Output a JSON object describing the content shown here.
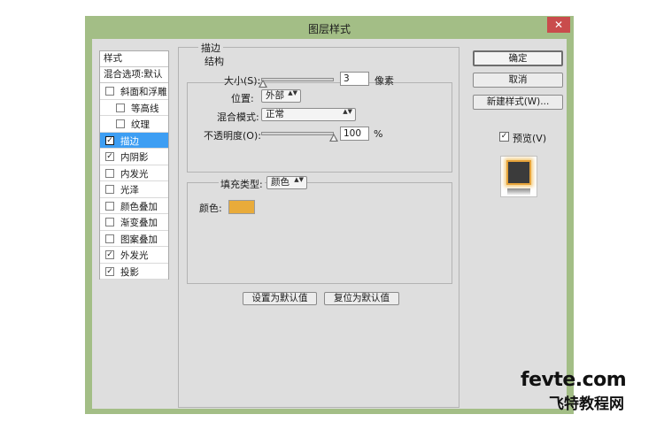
{
  "window": {
    "title": "图层样式",
    "close_glyph": "✕"
  },
  "sidebar": {
    "header": "样式",
    "blend_default": "混合选项:默认",
    "items": [
      {
        "label": "斜面和浮雕",
        "checked": false,
        "selected": false
      },
      {
        "label": "等高线",
        "checked": false,
        "selected": false
      },
      {
        "label": "纹理",
        "checked": false,
        "selected": false
      },
      {
        "label": "描边",
        "checked": true,
        "selected": true
      },
      {
        "label": "内阴影",
        "checked": true,
        "selected": false
      },
      {
        "label": "内发光",
        "checked": false,
        "selected": false
      },
      {
        "label": "光泽",
        "checked": false,
        "selected": false
      },
      {
        "label": "颜色叠加",
        "checked": false,
        "selected": false
      },
      {
        "label": "渐变叠加",
        "checked": false,
        "selected": false
      },
      {
        "label": "图案叠加",
        "checked": false,
        "selected": false
      },
      {
        "label": "外发光",
        "checked": true,
        "selected": false
      },
      {
        "label": "投影",
        "checked": true,
        "selected": false
      }
    ]
  },
  "stroke": {
    "title": "描边",
    "structure": {
      "title": "结构",
      "size_label": "大小(S):",
      "size_value": "3",
      "size_unit": "像素",
      "position_label": "位置:",
      "position_value": "外部",
      "blend_label": "混合模式:",
      "blend_value": "正常",
      "opacity_label": "不透明度(O):",
      "opacity_value": "100",
      "opacity_unit": "%"
    },
    "fill": {
      "type_label": "填充类型:",
      "type_value": "颜色",
      "color_label": "颜色:",
      "color_hex": "#e9ab3a"
    },
    "set_default_label": "设置为默认值",
    "reset_default_label": "复位为默认值"
  },
  "actions": {
    "ok_label": "确定",
    "cancel_label": "取消",
    "new_style_label": "新建样式(W)...",
    "preview_label": "预览(V)",
    "preview_checked": true
  },
  "watermark": {
    "url": "fevte.com",
    "name": "飞特教程网"
  },
  "check_glyph": "✓",
  "arrows_glyph": "▲▼"
}
